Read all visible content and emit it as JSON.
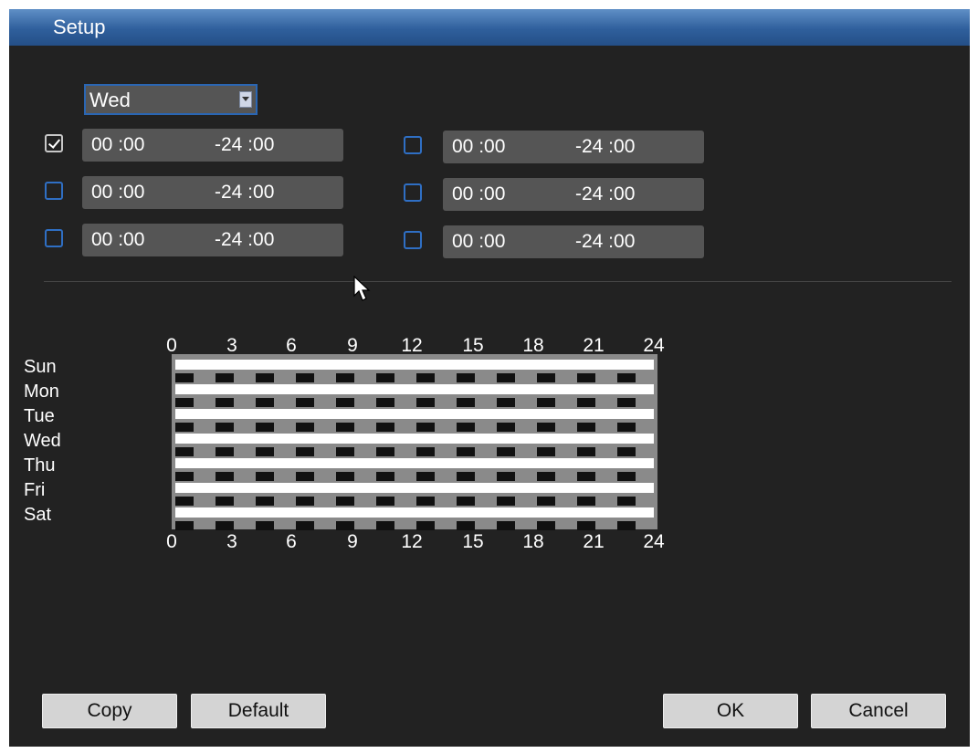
{
  "window": {
    "title": "Setup"
  },
  "day_select": {
    "value": "Wed"
  },
  "periods": [
    {
      "enabled": true,
      "start": "00 :00",
      "end": "-24 :00"
    },
    {
      "enabled": false,
      "start": "00 :00",
      "end": "-24 :00"
    },
    {
      "enabled": false,
      "start": "00 :00",
      "end": "-24 :00"
    },
    {
      "enabled": false,
      "start": "00 :00",
      "end": "-24 :00"
    },
    {
      "enabled": false,
      "start": "00 :00",
      "end": "-24 :00"
    },
    {
      "enabled": false,
      "start": "00 :00",
      "end": "-24 :00"
    }
  ],
  "schedule": {
    "days": [
      "Sun",
      "Mon",
      "Tue",
      "Wed",
      "Thu",
      "Fri",
      "Sat"
    ],
    "hour_ticks": [
      "0",
      "3",
      "6",
      "9",
      "12",
      "15",
      "18",
      "21",
      "24"
    ]
  },
  "buttons": {
    "copy": "Copy",
    "default": "Default",
    "ok": "OK",
    "cancel": "Cancel"
  },
  "colors": {
    "title_bar": "#2f5f9c",
    "background": "#222222",
    "field": "#555555",
    "checkbox_border": "#2f6fc4"
  }
}
